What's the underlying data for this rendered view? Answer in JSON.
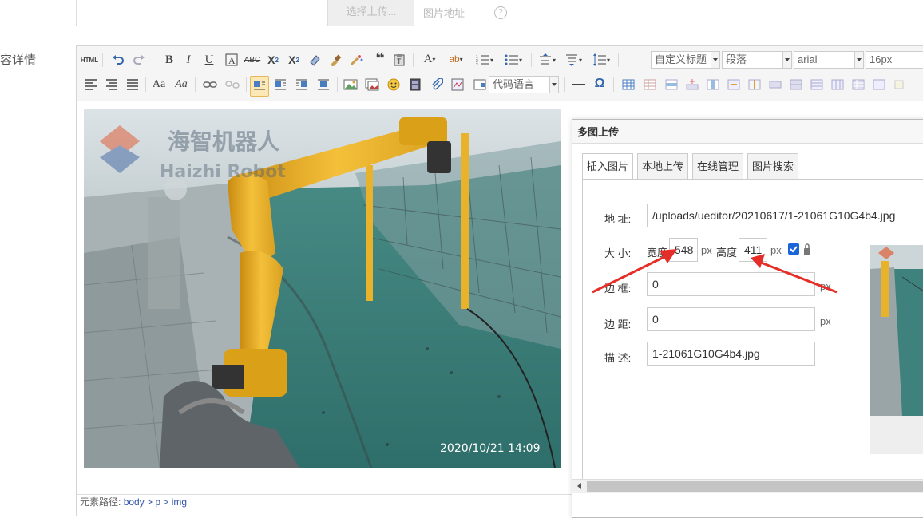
{
  "page": {
    "field_label": "容详情"
  },
  "top": {
    "button": "选择上传...",
    "hint": "图片地址",
    "help_icon": "?"
  },
  "toolbar": {
    "row1": [
      "html-source-icon",
      "undo-icon",
      "redo-icon",
      "bold-icon",
      "italic-icon",
      "underline-icon",
      "font-border-icon",
      "strikethrough-icon",
      "superscript-icon",
      "subscript-icon",
      "eraser-icon",
      "format-brush-icon",
      "auto-typeset-icon",
      "blockquote-icon",
      "paste-plain-icon",
      "font-color-icon",
      "highlight-icon",
      "ordered-list-icon",
      "unordered-list-icon",
      "row-spacing-top-icon",
      "row-spacing-bottom-icon",
      "line-height-icon"
    ],
    "combos": {
      "custom_title": "自定义标题",
      "paragraph": "段落",
      "font": "arial",
      "font_size": "16px"
    },
    "code_lang": "代码语言"
  },
  "photo": {
    "timestamp": "2020/10/21  14:09",
    "watermark_cn": "海智机器人",
    "watermark_en": "Haizhi Robot"
  },
  "element_path": {
    "label": "元素路径:",
    "parts": "body > p > img"
  },
  "dialog": {
    "title": "多图上传",
    "tabs": [
      "插入图片",
      "本地上传",
      "在线管理",
      "图片搜索"
    ],
    "address_label": "地 址:",
    "address_value": "/uploads/ueditor/20210617/1-21061G10G4b4.jpg",
    "size_label": "大 小:",
    "width_label": "宽度",
    "width_value": "548",
    "height_label": "高度",
    "height_value": "411",
    "unit": "px",
    "lock_checked": true,
    "border_label": "边 框:",
    "border_value": "0",
    "margin_label": "边 距:",
    "margin_value": "0",
    "desc_label": "描 述:",
    "desc_value": "1-21061G10G4b4.jpg"
  },
  "colors": {
    "annotation_arrow": "#e62e28",
    "active_btn": "#fbe8b4",
    "photo_floor": "#3b7e7a",
    "robot_arm": "#f0b830"
  }
}
